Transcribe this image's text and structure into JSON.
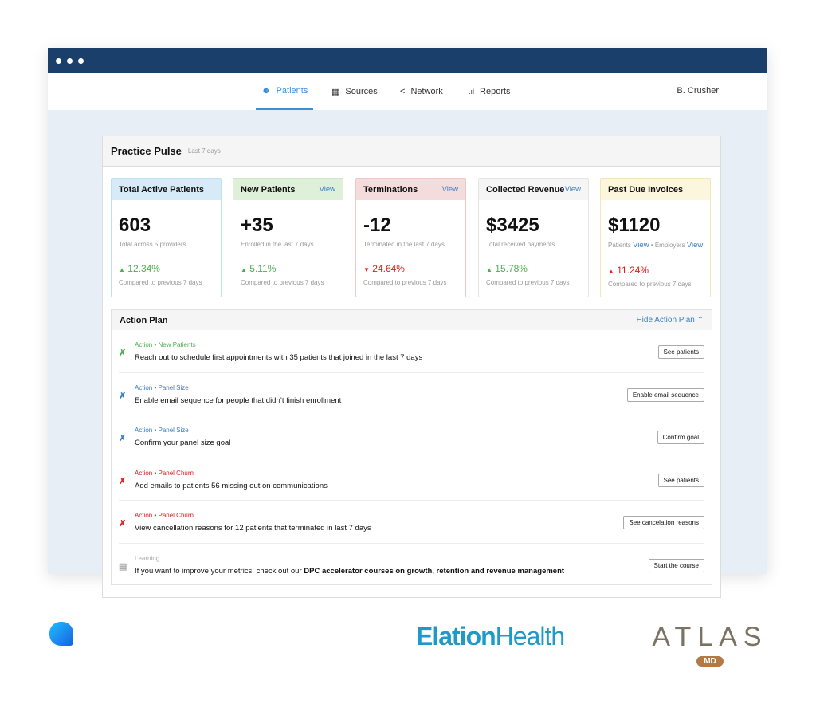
{
  "nav": {
    "items": [
      {
        "label": "Patients",
        "icon": "user-icon",
        "active": true
      },
      {
        "label": "Sources",
        "icon": "building-icon"
      },
      {
        "label": "Network",
        "icon": "share-icon"
      },
      {
        "label": "Reports",
        "icon": "bar-chart-icon"
      }
    ],
    "user": "B. Crusher"
  },
  "pulse": {
    "title": "Practice Pulse",
    "period": "Last 7 days"
  },
  "stats": [
    {
      "title": "Total Active Patients",
      "value": "603",
      "sub": "Total across 5 providers",
      "pct": "12.34%",
      "dir": "up",
      "compare": "Compared to previous 7 days",
      "color": "#d6ebf7"
    },
    {
      "title": "New Patients",
      "view": "View",
      "value": "+35",
      "sub": "Enrolled in the last 7 days",
      "pct": "5.11%",
      "dir": "up",
      "compare": "Compared to previous 7 days",
      "color": "#dff0d8"
    },
    {
      "title": "Terminations",
      "view": "View",
      "value": "-12",
      "sub": "Terminated in the last 7 days",
      "pct": "24.64%",
      "dir": "down",
      "compare": "Compared to previous 7 days",
      "color": "#f5dcdc"
    },
    {
      "title": "Collected Revenue",
      "view": "View",
      "value": "$3425",
      "sub": "Total received payments",
      "pct": "15.78%",
      "dir": "up",
      "compare": "Compared to previous 7 days",
      "color": "#f5f5f5"
    },
    {
      "title": "Past Due Invoices",
      "value": "$1120",
      "sub_parts": [
        "Patients",
        "View",
        "• Employers",
        "View"
      ],
      "pct": "11.24%",
      "dir": "up-red",
      "compare": "Compared to previous 7 days",
      "color": "#fcf6dc"
    }
  ],
  "action_plan": {
    "title": "Action Plan",
    "hide": "Hide Action Plan",
    "rows": [
      {
        "tag": "Action • New Patients",
        "tone": "g",
        "text": "Reach out to schedule first appointments with 35 patients that joined in the last 7 days",
        "button": "See patients"
      },
      {
        "tag": "Action • Panel Size",
        "tone": "b",
        "text": "Enable email sequence for people that didn’t finish enrollment",
        "button": "Enable email sequence"
      },
      {
        "tag": "Action • Panel Size",
        "tone": "b",
        "text": "Confirm your panel size goal",
        "button": "Confirm goal"
      },
      {
        "tag": "Action • Panel Churn",
        "tone": "r",
        "text": "Add emails to patients 56 missing out on communications",
        "button": "See patients"
      },
      {
        "tag": "Action • Panel Churn",
        "tone": "r",
        "text": "View cancellation reasons for 12 patients that terminated in last 7 days",
        "button": "See cancelation reasons"
      },
      {
        "tag": "Learning",
        "tone": "gr",
        "text": "If you want to improve your metrics, check out our ",
        "bold": "DPC accelerator courses on growth, retention and revenue management",
        "button": "Start the course"
      }
    ]
  },
  "logos": {
    "elation": "ElationHealth",
    "atlas": "ATLAS",
    "atlas_badge": "MD"
  }
}
